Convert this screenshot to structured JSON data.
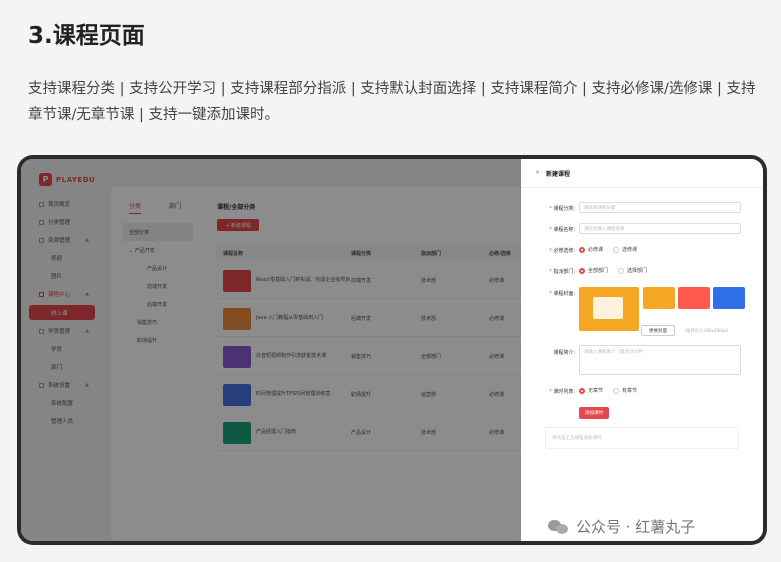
{
  "heading": "3.课程页面",
  "description": "支持课程分类 | 支持公开学习 | 支持课程部分指派 | 支持默认封面选择 | 支持课程简介 | 支持必修课/选修课 | 支持章节课/无章节课 | 支持一键添加课时。",
  "app": {
    "logo_mark": "P",
    "logo_text": "PLAYEDU",
    "menu": [
      {
        "label": "首页概览",
        "type": "top"
      },
      {
        "label": "分类管理",
        "type": "top"
      },
      {
        "label": "资源管理",
        "type": "group",
        "arrow": "▲"
      },
      {
        "label": "视频",
        "type": "sub"
      },
      {
        "label": "图片",
        "type": "sub"
      },
      {
        "label": "课程中心",
        "type": "group-red",
        "arrow": "▲"
      },
      {
        "label": "线上课",
        "type": "active"
      },
      {
        "label": "学员管理",
        "type": "group",
        "arrow": "▲"
      },
      {
        "label": "学员",
        "type": "sub"
      },
      {
        "label": "部门",
        "type": "sub"
      },
      {
        "label": "系统设置",
        "type": "group",
        "arrow": "▲"
      },
      {
        "label": "系统配置",
        "type": "sub"
      },
      {
        "label": "管理人员",
        "type": "sub"
      }
    ],
    "tabs": [
      "分类",
      "部门"
    ],
    "category_tree": [
      {
        "label": "全部分类",
        "level": 0,
        "on": true
      },
      {
        "label": "⌄ 产品开发",
        "level": 0
      },
      {
        "label": "产品设计",
        "level": 2
      },
      {
        "label": "前端开发",
        "level": 2
      },
      {
        "label": "后端开发",
        "level": 2
      },
      {
        "label": "销售技巧",
        "level": 1
      },
      {
        "label": "职场提升",
        "level": 1
      }
    ],
    "breadcrumb": "课程/全部分类",
    "new_button": "+ 新建课程",
    "columns": [
      "课程名称",
      "课程分类",
      "指派部门",
      "必修/选修"
    ],
    "rows": [
      {
        "title": "React零基础入门到实战、完成企业级项目",
        "category": "前端开发",
        "dept": "技术部",
        "type": "必修课",
        "color": "#e5484d"
      },
      {
        "title": "Java 入门教程从零基础到入门",
        "category": "后端开发",
        "dept": "技术部",
        "type": "必修课",
        "color": "#f08a3c"
      },
      {
        "title": "抖音短视频制作引流获客技术课",
        "category": "销售技巧",
        "dept": "全部部门",
        "type": "必修课",
        "color": "#8a5bd1"
      },
      {
        "title": "时间管理提升TPS时间管理训练营",
        "category": "职场提升",
        "dept": "运营部",
        "type": "必修课",
        "color": "#4a6fe3"
      },
      {
        "title": "产品经理入门指南",
        "category": "产品设计",
        "dept": "技术部",
        "type": "必修课",
        "color": "#1aa37a"
      }
    ]
  },
  "drawer": {
    "close": "✕",
    "title": "新建课程",
    "fields": {
      "category_label": "课程分类:",
      "category_placeholder": "请选择课程分类",
      "name_label": "课程名称:",
      "name_placeholder": "请在此输入课程名称",
      "required_label": "必修选修:",
      "required_options": [
        "必修课",
        "选修课"
      ],
      "assign_label": "指派部门:",
      "assign_options": [
        "全部部门",
        "选择部门"
      ],
      "cover_label": "课程封面:",
      "change_cover": "更换封面",
      "cover_hint": "(推荐尺寸:400x300px)",
      "intro_label": "课程简介:",
      "intro_placeholder": "请输入课程简介（最多200字）",
      "lesson_label": "课时列表:",
      "lesson_options": [
        "无章节",
        "有章节"
      ],
      "add_lesson": "添加课时",
      "empty_hint": "请点击上方按钮添加课时"
    },
    "cover_colors": [
      "#f5a623",
      "#ff5a4e",
      "#2f6fe8"
    ]
  },
  "watermark": "公众号 · 红薯丸子"
}
